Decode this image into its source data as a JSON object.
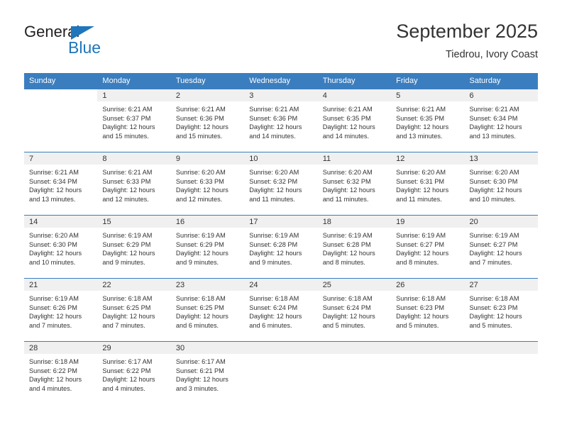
{
  "logo": {
    "word1": "General",
    "word2": "Blue",
    "triangle_color": "#1f76bc"
  },
  "header": {
    "title": "September 2025",
    "subtitle": "Tiedrou, Ivory Coast"
  },
  "theme": {
    "header_blue": "#3a7ebf",
    "daynum_strip": "#f0f0f0",
    "text": "#333333"
  },
  "weekday_headers": [
    "Sunday",
    "Monday",
    "Tuesday",
    "Wednesday",
    "Thursday",
    "Friday",
    "Saturday"
  ],
  "labels": {
    "sunrise_prefix": "Sunrise:",
    "sunset_prefix": "Sunset:",
    "daylight_prefix": "Daylight:"
  },
  "weeks": [
    [
      {
        "day": "",
        "blank": true
      },
      {
        "day": "1",
        "sunrise": "Sunrise: 6:21 AM",
        "sunset": "Sunset: 6:37 PM",
        "daylight1": "Daylight: 12 hours",
        "daylight2": "and 15 minutes."
      },
      {
        "day": "2",
        "sunrise": "Sunrise: 6:21 AM",
        "sunset": "Sunset: 6:36 PM",
        "daylight1": "Daylight: 12 hours",
        "daylight2": "and 15 minutes."
      },
      {
        "day": "3",
        "sunrise": "Sunrise: 6:21 AM",
        "sunset": "Sunset: 6:36 PM",
        "daylight1": "Daylight: 12 hours",
        "daylight2": "and 14 minutes."
      },
      {
        "day": "4",
        "sunrise": "Sunrise: 6:21 AM",
        "sunset": "Sunset: 6:35 PM",
        "daylight1": "Daylight: 12 hours",
        "daylight2": "and 14 minutes."
      },
      {
        "day": "5",
        "sunrise": "Sunrise: 6:21 AM",
        "sunset": "Sunset: 6:35 PM",
        "daylight1": "Daylight: 12 hours",
        "daylight2": "and 13 minutes."
      },
      {
        "day": "6",
        "sunrise": "Sunrise: 6:21 AM",
        "sunset": "Sunset: 6:34 PM",
        "daylight1": "Daylight: 12 hours",
        "daylight2": "and 13 minutes."
      }
    ],
    [
      {
        "day": "7",
        "sunrise": "Sunrise: 6:21 AM",
        "sunset": "Sunset: 6:34 PM",
        "daylight1": "Daylight: 12 hours",
        "daylight2": "and 13 minutes."
      },
      {
        "day": "8",
        "sunrise": "Sunrise: 6:21 AM",
        "sunset": "Sunset: 6:33 PM",
        "daylight1": "Daylight: 12 hours",
        "daylight2": "and 12 minutes."
      },
      {
        "day": "9",
        "sunrise": "Sunrise: 6:20 AM",
        "sunset": "Sunset: 6:33 PM",
        "daylight1": "Daylight: 12 hours",
        "daylight2": "and 12 minutes."
      },
      {
        "day": "10",
        "sunrise": "Sunrise: 6:20 AM",
        "sunset": "Sunset: 6:32 PM",
        "daylight1": "Daylight: 12 hours",
        "daylight2": "and 11 minutes."
      },
      {
        "day": "11",
        "sunrise": "Sunrise: 6:20 AM",
        "sunset": "Sunset: 6:32 PM",
        "daylight1": "Daylight: 12 hours",
        "daylight2": "and 11 minutes."
      },
      {
        "day": "12",
        "sunrise": "Sunrise: 6:20 AM",
        "sunset": "Sunset: 6:31 PM",
        "daylight1": "Daylight: 12 hours",
        "daylight2": "and 11 minutes."
      },
      {
        "day": "13",
        "sunrise": "Sunrise: 6:20 AM",
        "sunset": "Sunset: 6:30 PM",
        "daylight1": "Daylight: 12 hours",
        "daylight2": "and 10 minutes."
      }
    ],
    [
      {
        "day": "14",
        "sunrise": "Sunrise: 6:20 AM",
        "sunset": "Sunset: 6:30 PM",
        "daylight1": "Daylight: 12 hours",
        "daylight2": "and 10 minutes."
      },
      {
        "day": "15",
        "sunrise": "Sunrise: 6:19 AM",
        "sunset": "Sunset: 6:29 PM",
        "daylight1": "Daylight: 12 hours",
        "daylight2": "and 9 minutes."
      },
      {
        "day": "16",
        "sunrise": "Sunrise: 6:19 AM",
        "sunset": "Sunset: 6:29 PM",
        "daylight1": "Daylight: 12 hours",
        "daylight2": "and 9 minutes."
      },
      {
        "day": "17",
        "sunrise": "Sunrise: 6:19 AM",
        "sunset": "Sunset: 6:28 PM",
        "daylight1": "Daylight: 12 hours",
        "daylight2": "and 9 minutes."
      },
      {
        "day": "18",
        "sunrise": "Sunrise: 6:19 AM",
        "sunset": "Sunset: 6:28 PM",
        "daylight1": "Daylight: 12 hours",
        "daylight2": "and 8 minutes."
      },
      {
        "day": "19",
        "sunrise": "Sunrise: 6:19 AM",
        "sunset": "Sunset: 6:27 PM",
        "daylight1": "Daylight: 12 hours",
        "daylight2": "and 8 minutes."
      },
      {
        "day": "20",
        "sunrise": "Sunrise: 6:19 AM",
        "sunset": "Sunset: 6:27 PM",
        "daylight1": "Daylight: 12 hours",
        "daylight2": "and 7 minutes."
      }
    ],
    [
      {
        "day": "21",
        "sunrise": "Sunrise: 6:19 AM",
        "sunset": "Sunset: 6:26 PM",
        "daylight1": "Daylight: 12 hours",
        "daylight2": "and 7 minutes."
      },
      {
        "day": "22",
        "sunrise": "Sunrise: 6:18 AM",
        "sunset": "Sunset: 6:25 PM",
        "daylight1": "Daylight: 12 hours",
        "daylight2": "and 7 minutes."
      },
      {
        "day": "23",
        "sunrise": "Sunrise: 6:18 AM",
        "sunset": "Sunset: 6:25 PM",
        "daylight1": "Daylight: 12 hours",
        "daylight2": "and 6 minutes."
      },
      {
        "day": "24",
        "sunrise": "Sunrise: 6:18 AM",
        "sunset": "Sunset: 6:24 PM",
        "daylight1": "Daylight: 12 hours",
        "daylight2": "and 6 minutes."
      },
      {
        "day": "25",
        "sunrise": "Sunrise: 6:18 AM",
        "sunset": "Sunset: 6:24 PM",
        "daylight1": "Daylight: 12 hours",
        "daylight2": "and 5 minutes."
      },
      {
        "day": "26",
        "sunrise": "Sunrise: 6:18 AM",
        "sunset": "Sunset: 6:23 PM",
        "daylight1": "Daylight: 12 hours",
        "daylight2": "and 5 minutes."
      },
      {
        "day": "27",
        "sunrise": "Sunrise: 6:18 AM",
        "sunset": "Sunset: 6:23 PM",
        "daylight1": "Daylight: 12 hours",
        "daylight2": "and 5 minutes."
      }
    ],
    [
      {
        "day": "28",
        "sunrise": "Sunrise: 6:18 AM",
        "sunset": "Sunset: 6:22 PM",
        "daylight1": "Daylight: 12 hours",
        "daylight2": "and 4 minutes."
      },
      {
        "day": "29",
        "sunrise": "Sunrise: 6:17 AM",
        "sunset": "Sunset: 6:22 PM",
        "daylight1": "Daylight: 12 hours",
        "daylight2": "and 4 minutes."
      },
      {
        "day": "30",
        "sunrise": "Sunrise: 6:17 AM",
        "sunset": "Sunset: 6:21 PM",
        "daylight1": "Daylight: 12 hours",
        "daylight2": "and 3 minutes."
      },
      {
        "day": "",
        "empty": true
      },
      {
        "day": "",
        "empty": true
      },
      {
        "day": "",
        "empty": true
      },
      {
        "day": "",
        "empty": true
      }
    ]
  ]
}
